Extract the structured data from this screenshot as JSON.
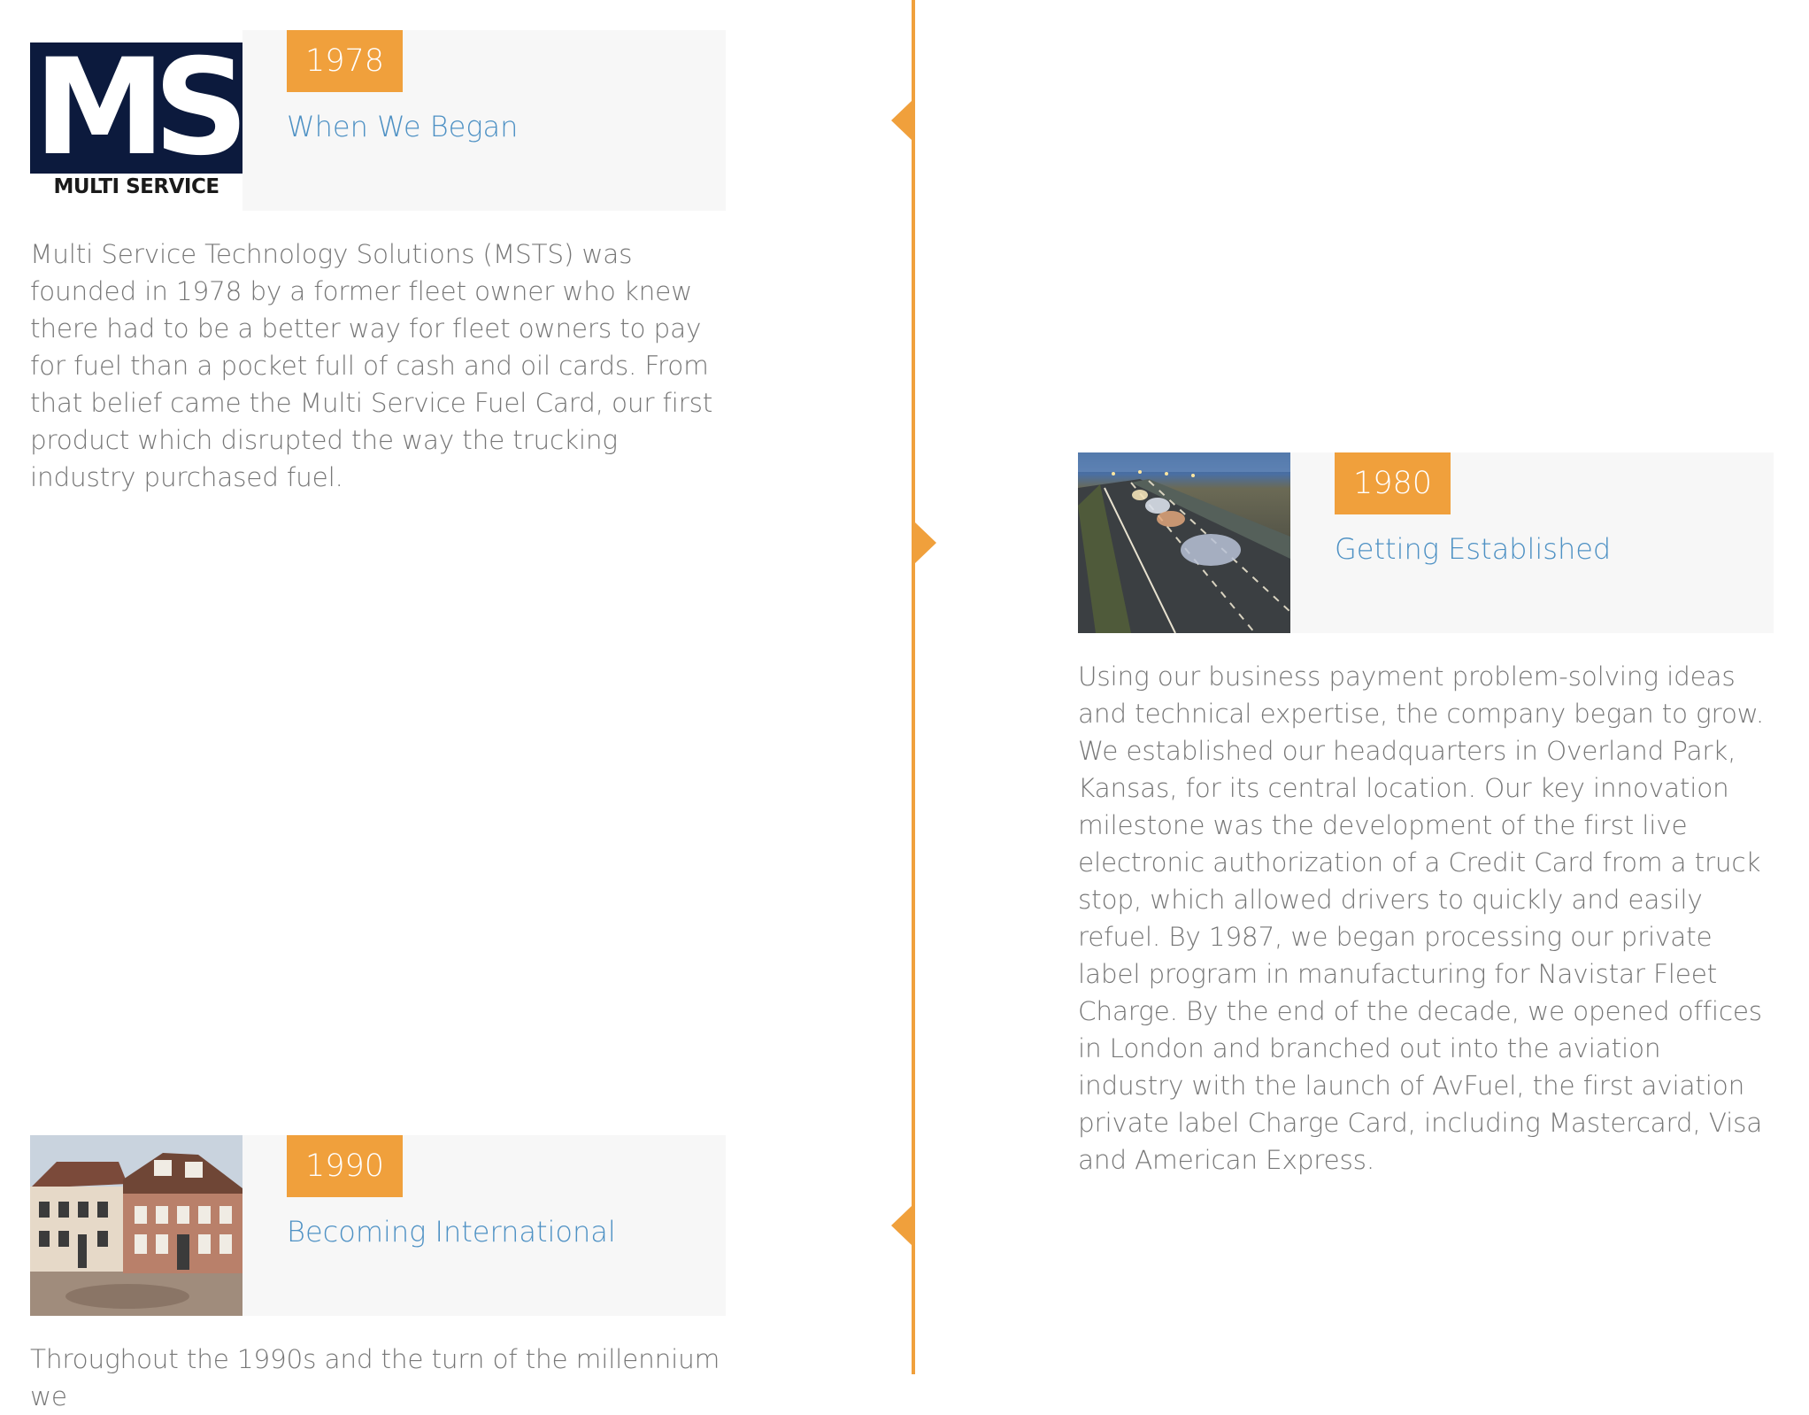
{
  "colors": {
    "accent": "#f0a03c",
    "title_link": "#4e91c4",
    "body_text": "#777777",
    "card_bg": "#f7f7f7"
  },
  "logo": {
    "letters": "MS",
    "caption": "MULTI SERVICE"
  },
  "entries": [
    {
      "year": "1978",
      "title": "When We Began",
      "image": "ms-logo",
      "body": "Multi Service Technology Solutions (MSTS) was founded in 1978 by a former fleet owner who knew there had to be a better way for fleet owners to pay for fuel than a pocket full of cash and oil cards. From that belief came the Multi Service Fuel Card, our first product which disrupted the way the trucking industry purchased fuel."
    },
    {
      "year": "1980",
      "title": "Getting Established",
      "image": "highway-photo",
      "body": "Using our business payment problem-solving ideas and technical expertise, the company began to grow. We established our headquarters in Overland Park, Kansas, for its central location. Our key innovation milestone was the development of the first live electronic authorization of a Credit Card from a truck stop, which allowed drivers to quickly and easily refuel.  By 1987, we began processing our private label program in manufacturing for Navistar Fleet Charge. By the end of the decade, we opened offices in London and branched out into the aviation industry with the launch of AvFuel, the first aviation private label Charge Card, including Mastercard, Visa and American Express."
    },
    {
      "year": "1990",
      "title": "Becoming International",
      "image": "building-photo",
      "body": "Throughout the 1990s and the turn of the millennium we"
    }
  ]
}
